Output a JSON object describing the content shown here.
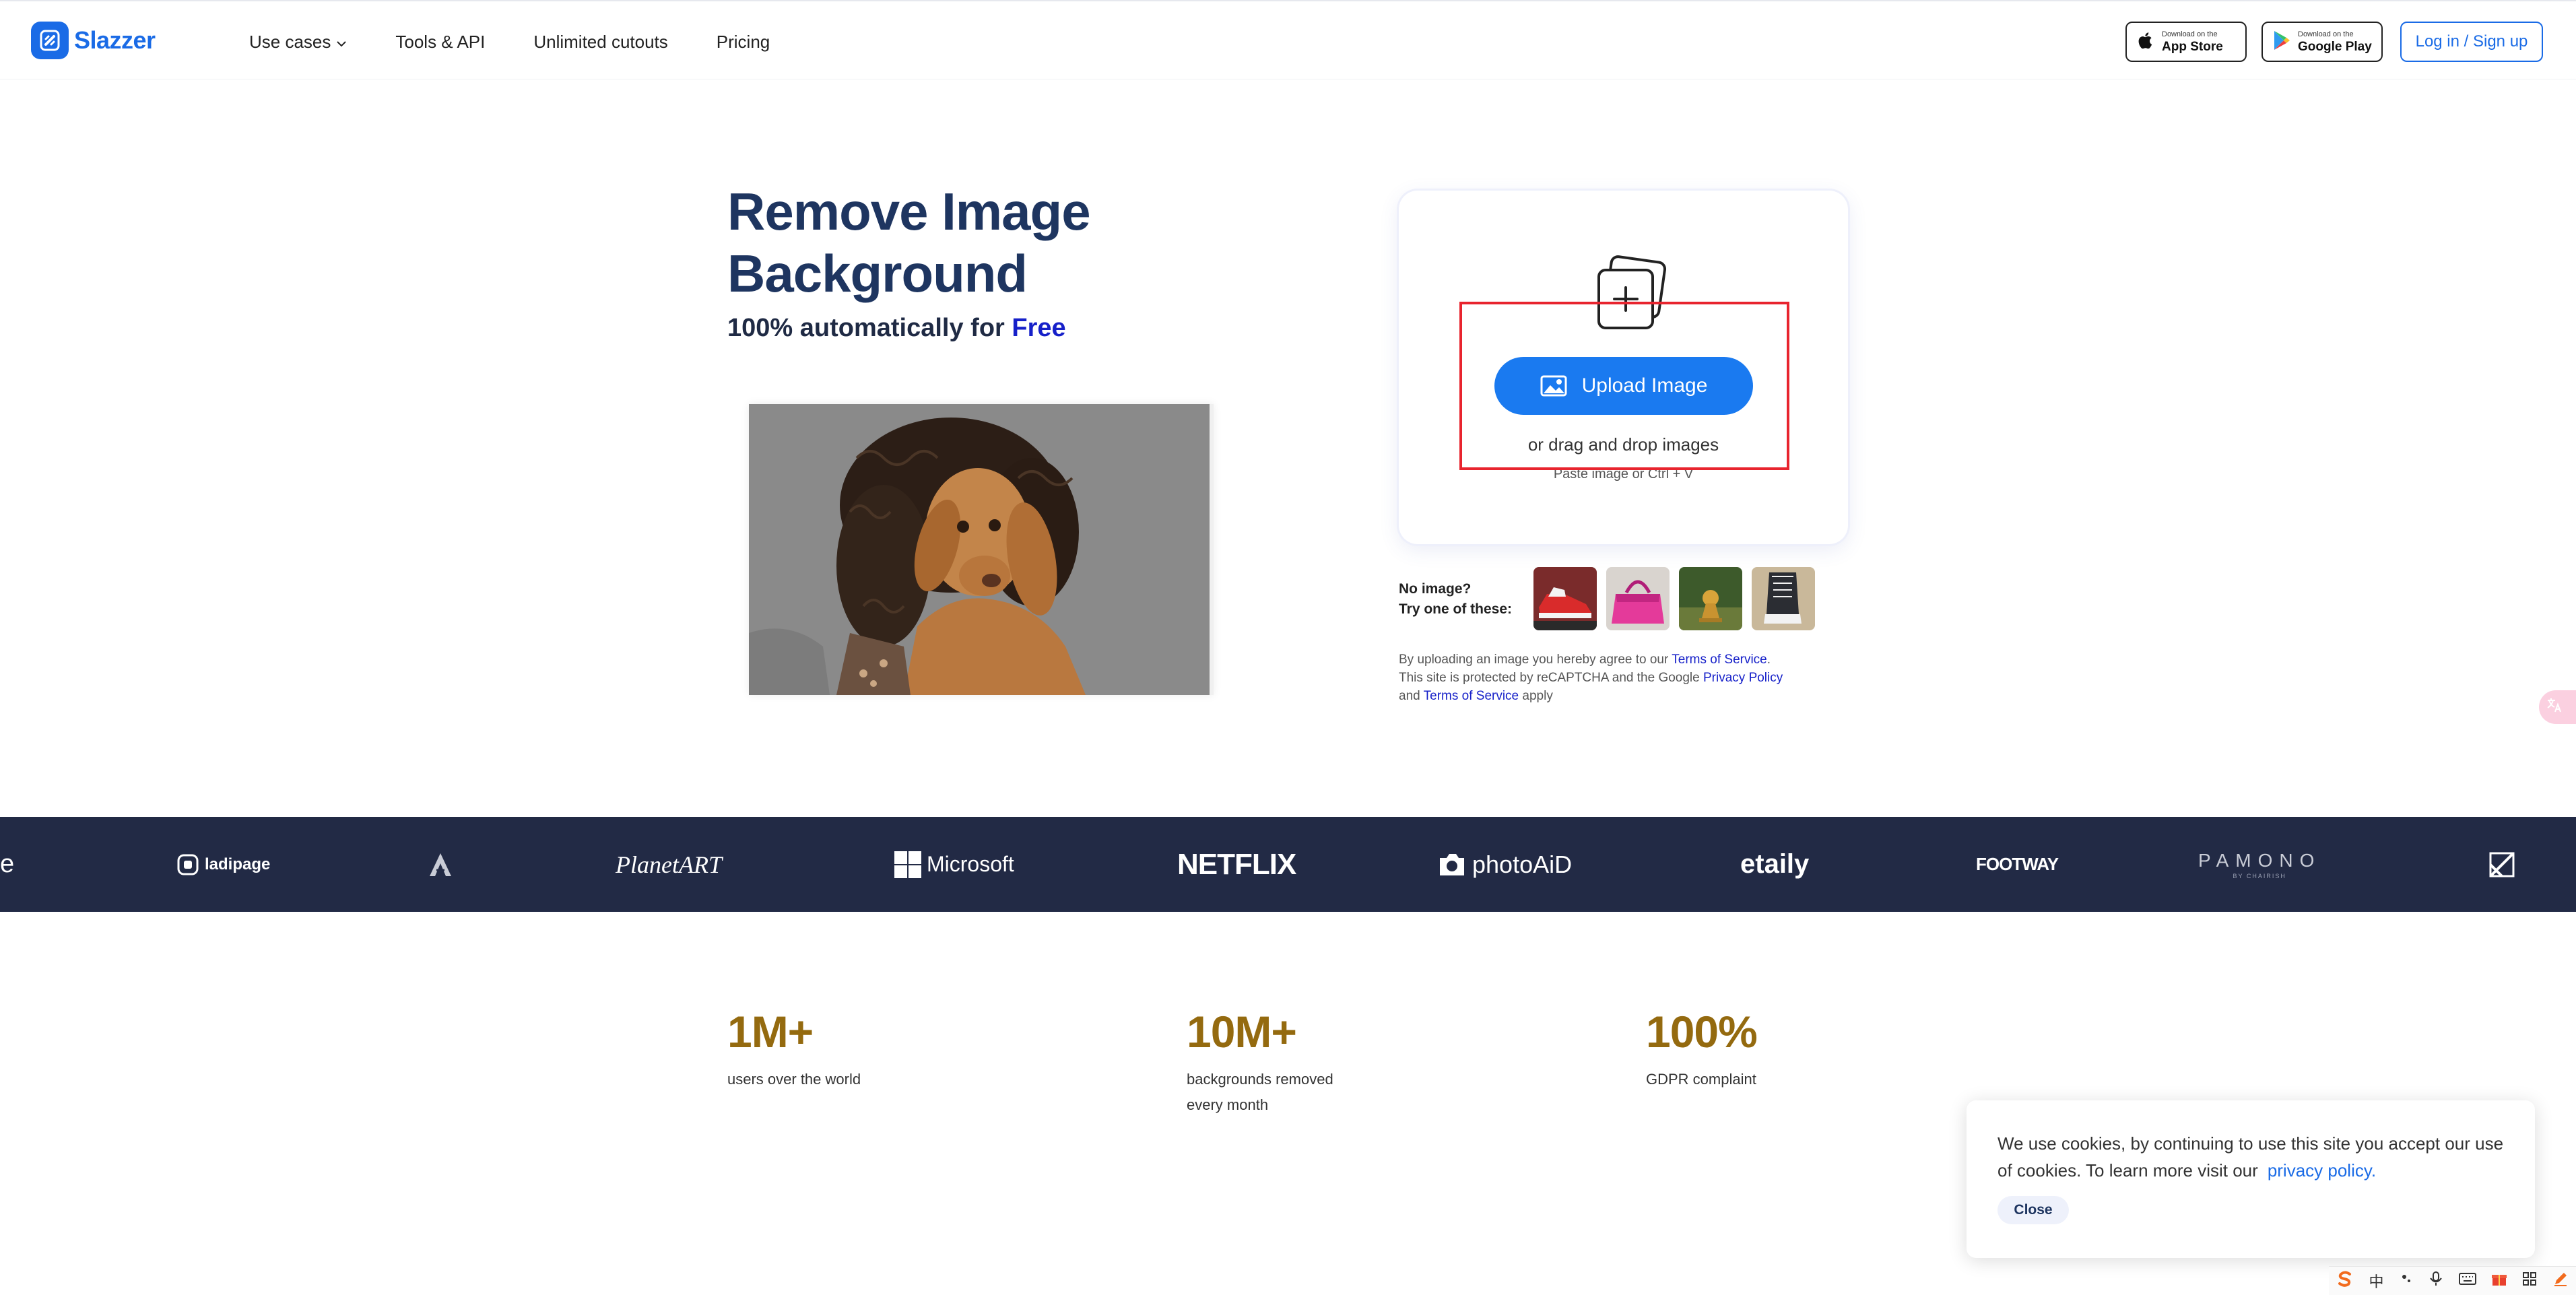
{
  "header": {
    "logo_text": "Slazzer",
    "nav": [
      {
        "label": "Use cases"
      },
      {
        "label": "Tools & API"
      },
      {
        "label": "Unlimited cutouts"
      },
      {
        "label": "Pricing"
      }
    ],
    "app_store": {
      "small": "Download on the",
      "big": "App Store"
    },
    "google_play": {
      "small": "Download on the",
      "big": "Google Play"
    },
    "login_label": "Log in / Sign up"
  },
  "hero": {
    "title_line1": "Remove Image",
    "title_line2": "Background",
    "subtitle": "100% automatically for",
    "subtitle_highlight": "Free",
    "subtitle_highlight_color": "#1620c9"
  },
  "upload": {
    "button_label": "Upload Image",
    "drag_text": "or drag and drop images",
    "paste_text": "Paste image or Ctrl + V"
  },
  "samples": {
    "prompt_line1": "No image?",
    "prompt_line2": "Try one of these:",
    "items": [
      "red-sneaker",
      "pink-handbag",
      "bronze-figurine",
      "black-sneaker"
    ]
  },
  "legal": {
    "part1": "By uploading an image you hereby agree to our ",
    "tos_link": "Terms of Service",
    "part2": ".",
    "part3": "This site is protected by reCAPTCHA and the Google ",
    "privacy_link": "Privacy Policy",
    "part4": "and ",
    "tos_link2": "Terms of Service",
    "part5": " apply"
  },
  "brands": {
    "partial_left": "e",
    "ladipage": "ladipage",
    "planetart": "PlanetART",
    "microsoft": "Microsoft",
    "netflix": "NETFLIX",
    "photoaid": "photoAiD",
    "etaily": "etaily",
    "footway": "FOOTWAY",
    "pamono": "PAMONO",
    "pamono_sub": "BY CHAIRISH"
  },
  "stats": [
    {
      "value": "1M+",
      "label": "users over the world"
    },
    {
      "value": "10M+",
      "label": "backgrounds removed every month"
    },
    {
      "value": "100%",
      "label": "GDPR complaint"
    }
  ],
  "cookie": {
    "text": "We use cookies, by continuing to use this site you accept our use of cookies.  To learn more visit our",
    "link": "privacy policy.",
    "close_label": "Close"
  },
  "tray": {
    "ime": "中",
    "icons": [
      "sogou-icon",
      "dot-icon",
      "mic-icon",
      "keyboard-icon",
      "gift-icon",
      "grid-icon",
      "pen-icon"
    ]
  },
  "colors": {
    "brand_blue": "#1a6be6",
    "title_navy": "#1e3560",
    "stat_gold": "#946a0f",
    "strip_bg": "#222a45",
    "highlight_box": "#e8242e"
  }
}
